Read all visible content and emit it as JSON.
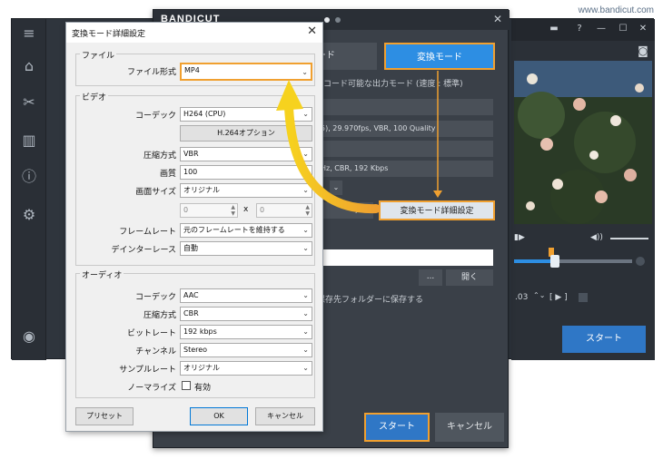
{
  "watermark": "www.bandicut.com",
  "main_window": {
    "right_start_label": "スタート",
    "player_time": ".03",
    "player_bracket": "[ ▶ ]"
  },
  "encode_window": {
    "logo": "BANDICUT",
    "tab_normal": "モード",
    "tab_encode": "変換モード",
    "description": "ンコード可能な出力モード (速度 : 標準)",
    "fields": [
      "",
      "5), 29.970fps, VBR, 100 Quality",
      "",
      "Hz, CBR, 192 Kbps"
    ],
    "preset_button_fragment": "ット",
    "advanced_button": "変換モード詳細設定",
    "browse_button": "...",
    "open_button": "開く",
    "save_checkbox_text": "保存先フォルダーに保存する",
    "start_button": "スタート",
    "cancel_button": "キャンセル"
  },
  "dialog": {
    "title": "変換モード詳細設定",
    "file_group": "ファイル",
    "file_format_label": "ファイル形式",
    "file_format_value": "MP4",
    "video_group": "ビデオ",
    "codec_label": "コーデック",
    "codec_value": "H264 (CPU)",
    "h264_option_button": "H.264オプション",
    "compression_label": "圧縮方式",
    "compression_value": "VBR",
    "quality_label": "画質",
    "quality_value": "100",
    "screen_size_label": "画面サイズ",
    "screen_size_value": "オリジナル",
    "width_value": "0",
    "size_x": "x",
    "height_value": "0",
    "framerate_label": "フレームレート",
    "framerate_value": "元のフレームレートを維持する",
    "deinterlace_label": "デインターレース",
    "deinterlace_value": "自動",
    "audio_group": "オーディオ",
    "audio_codec_label": "コーデック",
    "audio_codec_value": "AAC",
    "audio_compression_label": "圧縮方式",
    "audio_compression_value": "CBR",
    "bitrate_label": "ビットレート",
    "bitrate_value": "192 kbps",
    "channel_label": "チャンネル",
    "channel_value": "Stereo",
    "samplerate_label": "サンプルレート",
    "samplerate_value": "オリジナル",
    "normalize_label": "ノーマライズ",
    "normalize_checkbox": "有効",
    "preset_button": "プリセット",
    "ok_button": "OK",
    "cancel_button": "キャンセル"
  },
  "colors": {
    "highlight": "#f0a030",
    "accent_blue": "#2d8ee3",
    "dark_bg": "#3a4048"
  }
}
